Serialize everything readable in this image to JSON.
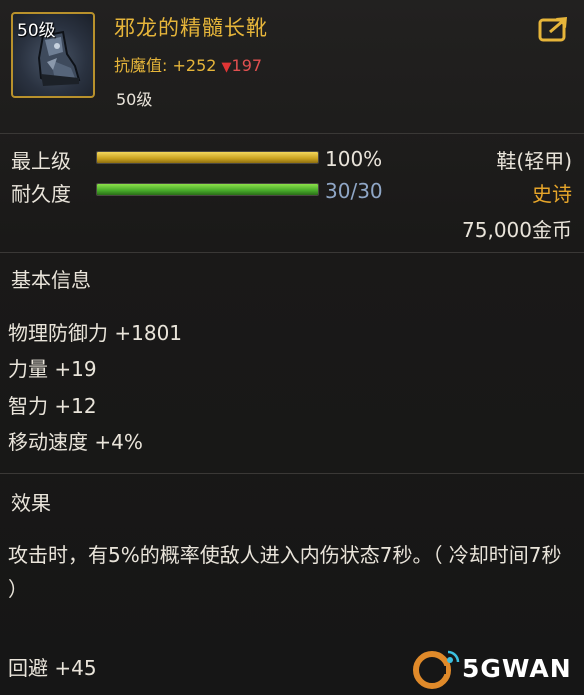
{
  "item": {
    "icon_level": "50级",
    "name": "邪龙的精髓长靴",
    "stat_label": "抗魔值:",
    "stat_change_up": "+252",
    "stat_change_down": "197",
    "required_level": "50级"
  },
  "bars": {
    "level": {
      "label": "最上级",
      "value_text": "100%",
      "fill": 1.0
    },
    "durability": {
      "label": "耐久度",
      "value_text": "30/30",
      "fill": 1.0
    }
  },
  "meta": {
    "type": "鞋(轻甲)",
    "rarity": "史诗",
    "price": "75,000金币"
  },
  "basic_info": {
    "title": "基本信息",
    "attributes": [
      "物理防御力 +1801",
      "力量 +19",
      "智力 +12",
      "移动速度 +4%"
    ]
  },
  "effect": {
    "title": "效果",
    "description": "攻击时，有5%的概率使敌人进入内伤状态7秒。（ 冷却时间7秒 ）",
    "extra": "回避 +45"
  },
  "watermark": {
    "text": "5GWAN"
  },
  "colors": {
    "gold": "#e6b53a",
    "red": "#e03535",
    "blue": "#8fa6c6",
    "epic": "#e6a52a"
  },
  "icons": [
    "boots-item-icon",
    "share-icon",
    "down-arrow-icon",
    "watermark-logo-icon"
  ]
}
